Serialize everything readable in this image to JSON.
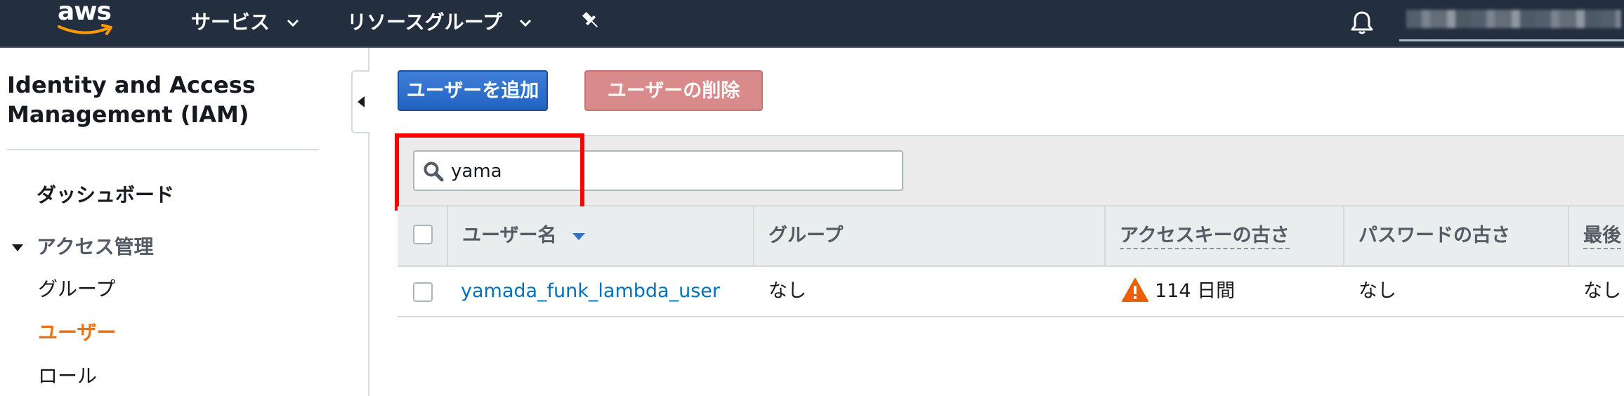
{
  "nav": {
    "logo_text": "aws",
    "services_label": "サービス",
    "resource_groups_label": "リソースグループ",
    "pin_icon": "pin-icon",
    "bell_icon": "bell-icon",
    "account_blurred": true
  },
  "sidebar": {
    "title": "Identity and Access Management (IAM)",
    "dashboard_label": "ダッシュボード",
    "access_management_label": "アクセス管理",
    "items": [
      {
        "label": "グループ",
        "active": false
      },
      {
        "label": "ユーザー",
        "active": true
      },
      {
        "label": "ロール",
        "active": false
      }
    ]
  },
  "toolbar": {
    "add_user_label": "ユーザーを追加",
    "delete_user_label": "ユーザーの削除"
  },
  "search": {
    "value": "yama"
  },
  "table": {
    "columns": [
      "ユーザー名",
      "グループ",
      "アクセスキーの古さ",
      "パスワードの古さ",
      "最後"
    ],
    "rows": [
      {
        "username": "yamada_funk_lambda_user",
        "groups": "なし",
        "access_key_age": "114 日間",
        "password_age": "なし",
        "last": "なし"
      }
    ]
  },
  "colors": {
    "nav_bg": "#232f3e",
    "primary_button": "#2e73d0",
    "danger_button_disabled": "#d98b8c",
    "active_nav": "#ec7211",
    "link": "#0073bb",
    "highlight_box": "#ff0000",
    "warning": "#eb5f07"
  }
}
